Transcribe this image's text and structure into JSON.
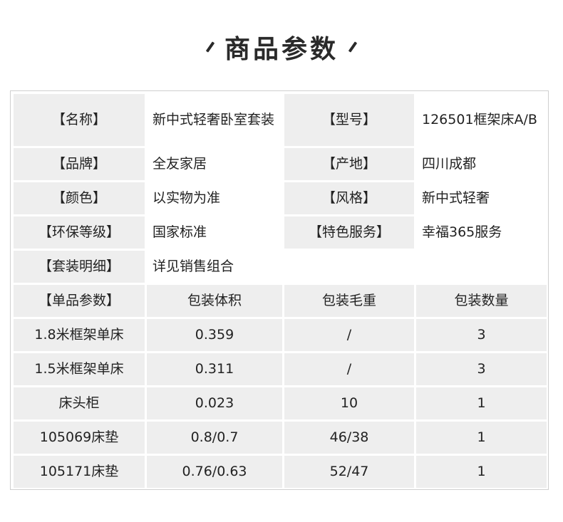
{
  "title": "商品参数",
  "info": {
    "name_label": "【名称】",
    "name_value": "新中式轻奢卧室套装",
    "model_label": "【型号】",
    "model_value": "126501框架床A/B",
    "brand_label": "【品牌】",
    "brand_value": "全友家居",
    "origin_label": "【产地】",
    "origin_value": "四川成都",
    "color_label": "【颜色】",
    "color_value": "以实物为准",
    "style_label": "【风格】",
    "style_value": "新中式轻奢",
    "eco_label": "【环保等级】",
    "eco_value": "国家标准",
    "service_label": "【特色服务】",
    "service_value": "幸福365服务",
    "set_label": "【套装明细】",
    "set_value": "详见销售组合"
  },
  "params": {
    "headers": [
      "【单品参数】",
      "包装体积",
      "包装毛重",
      "包装数量"
    ],
    "rows": [
      [
        "1.8米框架单床",
        "0.359",
        "/",
        "3"
      ],
      [
        "1.5米框架单床",
        "0.311",
        "/",
        "3"
      ],
      [
        "床头柜",
        "0.023",
        "10",
        "1"
      ],
      [
        "105069床垫",
        "0.8/0.7",
        "46/38",
        "1"
      ],
      [
        "105171床垫",
        "0.76/0.63",
        "52/47",
        "1"
      ]
    ]
  }
}
